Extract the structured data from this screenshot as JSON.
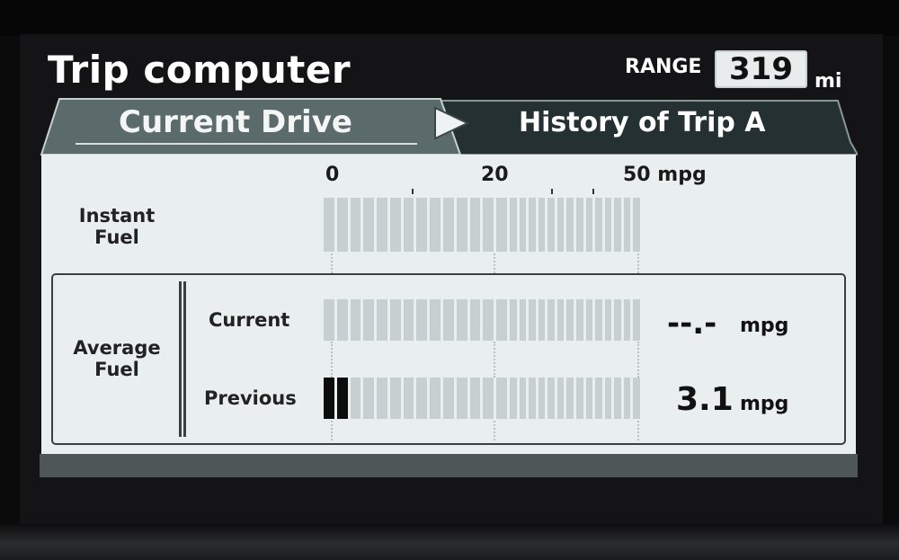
{
  "header": {
    "title": "Trip computer",
    "range_label": "RANGE",
    "range_value": "319",
    "range_unit": "mi"
  },
  "tabs": [
    {
      "label": "Current Drive",
      "active": true
    },
    {
      "label": "History of Trip A",
      "active": false
    }
  ],
  "scale": {
    "labels": [
      "0",
      "20",
      "50 mpg"
    ]
  },
  "instant_fuel": {
    "label_line1": "Instant",
    "label_line2": "Fuel",
    "segments_total": 28,
    "segments_filled": 0
  },
  "average_fuel": {
    "label_line1": "Average",
    "label_line2": "Fuel",
    "current": {
      "label": "Current",
      "value": "--.-",
      "unit": "mpg",
      "segments_total": 28,
      "segments_filled": 0
    },
    "previous": {
      "label": "Previous",
      "value": "3.1",
      "unit": "mpg",
      "segments_total": 28,
      "segments_filled": 2
    }
  },
  "colors": {
    "panel": "#e9eeee",
    "segment_off": "#c7d0d1",
    "segment_on": "#0c0c0c",
    "tab_active": "#5b6a6b",
    "tab_inactive": "#253033"
  }
}
